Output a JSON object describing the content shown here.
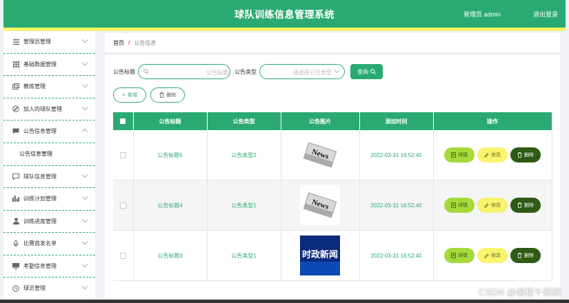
{
  "header": {
    "title": "球队训练信息管理系统",
    "user": "管理员 admin",
    "logout": "退出登录"
  },
  "sidebar": {
    "items": [
      {
        "label": "管理员管理",
        "icon": "list-icon"
      },
      {
        "label": "基础数据管理",
        "icon": "grid-icon"
      },
      {
        "label": "教练管理",
        "icon": "window-icon"
      },
      {
        "label": "加入的球队管理",
        "icon": "compass-icon"
      },
      {
        "label": "公告信息管理",
        "icon": "chat-icon",
        "expanded": true
      },
      {
        "label": "球队信息管理",
        "icon": "message-icon"
      },
      {
        "label": "训练计划管理",
        "icon": "chart-icon"
      },
      {
        "label": "训练进度管理",
        "icon": "user-icon"
      },
      {
        "label": "比赛首发名单",
        "icon": "mic-icon"
      },
      {
        "label": "考勤信息管理",
        "icon": "monitor-icon"
      },
      {
        "label": "球员管理",
        "icon": "clock-icon"
      }
    ],
    "sub_items": [
      {
        "label": "公告信息管理"
      }
    ]
  },
  "breadcrumb": {
    "home": "首页",
    "separator": "/",
    "current": "公告信息"
  },
  "search": {
    "title_label": "公告标题",
    "title_placeholder": "公告标题",
    "type_label": "公告类型",
    "type_placeholder": "请选择公告类型",
    "query_button": "查询"
  },
  "actions": {
    "add": "新增",
    "delete": "删除"
  },
  "table": {
    "columns": [
      "公告标题",
      "公告类型",
      "公告图片",
      "添加时间",
      "操作"
    ],
    "rows": [
      {
        "title": "公告标题5",
        "type": "公告类型2",
        "image": "news-paper",
        "time": "2022-03-31 16:52:40"
      },
      {
        "title": "公告标题4",
        "type": "公告类型1",
        "image": "news-paper",
        "time": "2022-03-31 16:52:40"
      },
      {
        "title": "公告标题3",
        "type": "公告类型1",
        "image": "current-affairs-news",
        "time": "2022-03-31 16:52:40"
      }
    ],
    "image_text": {
      "news": "News",
      "affairs": "时政新闻"
    },
    "op_labels": {
      "detail": "详情",
      "edit": "修改",
      "delete": "删除"
    }
  },
  "watermark": "CSDN @编程千纸鹤",
  "colors": {
    "primary": "#2aaa72",
    "accent": "#f7f56c",
    "detail": "#a6d93a",
    "edit": "#f8f46f",
    "delete": "#2f5a13"
  }
}
